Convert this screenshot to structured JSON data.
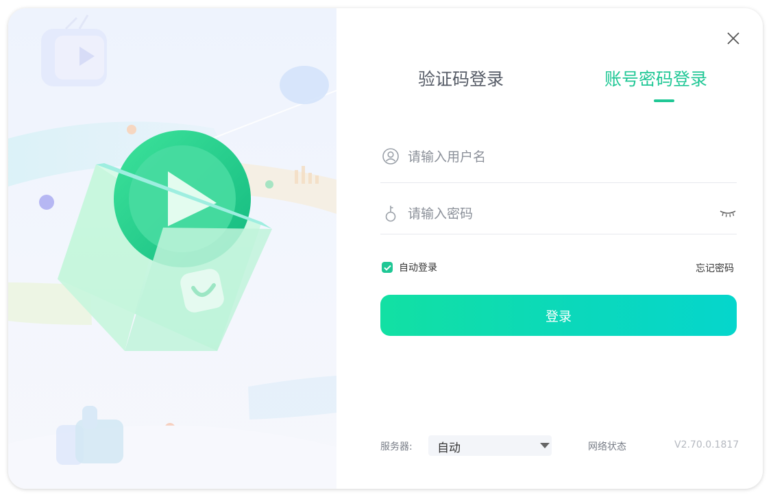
{
  "tabs": {
    "sms_login": "验证码登录",
    "password_login": "账号密码登录"
  },
  "form": {
    "username_placeholder": "请输入用户名",
    "username_value": "",
    "password_placeholder": "请输入密码",
    "password_value": "",
    "remember_label": "自动登录",
    "remember_checked": true,
    "forgot_label": "忘记密码",
    "login_label": "登录"
  },
  "footer": {
    "server_label": "服务器:",
    "server_value": "自动",
    "network_status": "网络状态",
    "version": "V2.70.0.1817"
  },
  "colors": {
    "accent": "#1fc795",
    "button_start": "#12e0a3",
    "button_end": "#05d6cc",
    "illustration_bg": "#eef3fd"
  },
  "icons": {
    "close": "close-icon",
    "user": "user-icon",
    "key": "key-icon",
    "eye": "eye-closed-icon",
    "check": "check-icon",
    "caret": "caret-down-icon"
  }
}
